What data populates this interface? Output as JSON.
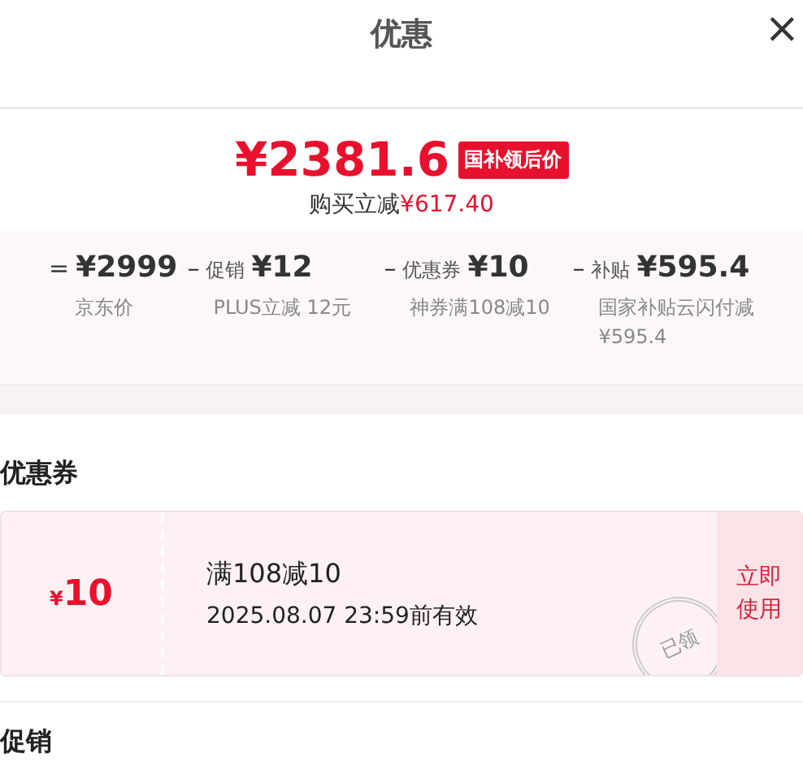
{
  "header": {
    "title": "优惠",
    "close": "×"
  },
  "price": {
    "amount": "¥2381.6",
    "badge": "国补领后价",
    "saving_label": "购买立减",
    "saving_amount": "¥617.40"
  },
  "breakdown": [
    {
      "op": "=",
      "amount": "¥2999",
      "notes": [
        "京东价"
      ]
    },
    {
      "op": "–",
      "label": "促销",
      "amount": "¥12",
      "notes": [
        "PLUS立减 12元"
      ]
    },
    {
      "op": "–",
      "label": "优惠券",
      "amount": "¥10",
      "notes": [
        "神券满108减10"
      ]
    },
    {
      "op": "–",
      "label": "补贴",
      "amount": "¥595.4",
      "notes": [
        "国家补贴云闪付减",
        "¥595.4"
      ]
    }
  ],
  "coupons_section": {
    "title": "优惠券"
  },
  "coupons": [
    {
      "value_symbol": "¥",
      "value": "10",
      "condition": "满108减10",
      "validity": "2025.08.07 23:59前有效",
      "stamp": "已领",
      "action": "立即使用"
    }
  ],
  "promo_section": {
    "title": "促销"
  }
}
